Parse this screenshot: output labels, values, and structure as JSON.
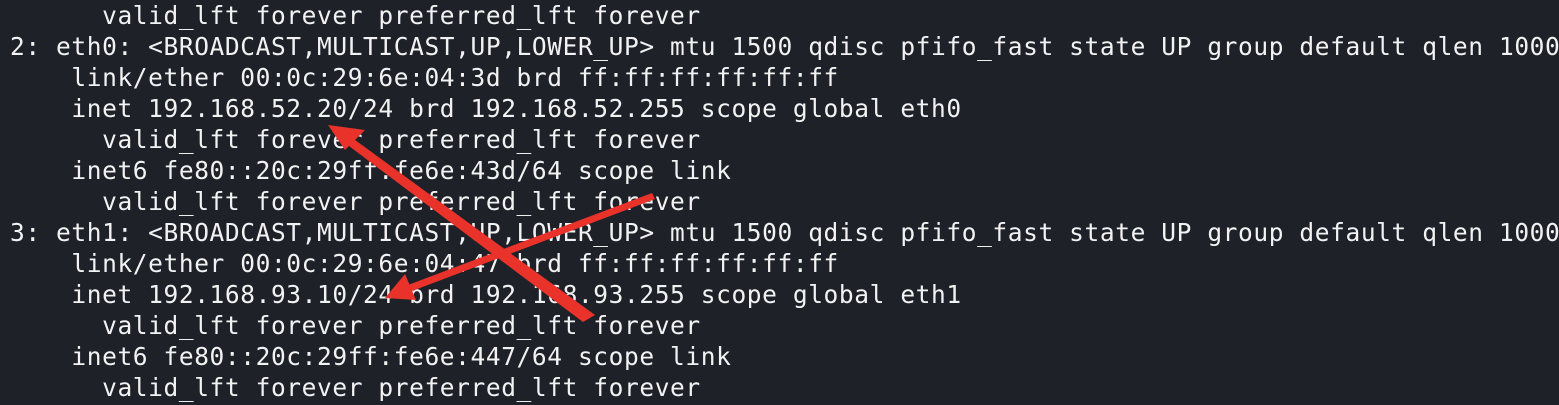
{
  "terminal": {
    "lines": [
      "      valid_lft forever preferred_lft forever",
      "2: eth0: <BROADCAST,MULTICAST,UP,LOWER_UP> mtu 1500 qdisc pfifo_fast state UP group default qlen 1000",
      "    link/ether 00:0c:29:6e:04:3d brd ff:ff:ff:ff:ff:ff",
      "    inet 192.168.52.20/24 brd 192.168.52.255 scope global eth0",
      "      valid_lft forever preferred_lft forever",
      "    inet6 fe80::20c:29ff:fe6e:43d/64 scope link",
      "      valid_lft forever preferred_lft forever",
      "3: eth1: <BROADCAST,MULTICAST,UP,LOWER_UP> mtu 1500 qdisc pfifo_fast state UP group default qlen 1000",
      "    link/ether 00:0c:29:6e:04:47 brd ff:ff:ff:ff:ff:ff",
      "    inet 192.168.93.10/24 brd 192.168.93.255 scope global eth1",
      "      valid_lft forever preferred_lft forever",
      "    inet6 fe80::20c:29ff:fe6e:447/64 scope link",
      "      valid_lft forever preferred_lft forever"
    ]
  },
  "colors": {
    "background": "#1f2129",
    "text": "#f2f2f2",
    "annotation_arrow": "#e8322a"
  },
  "annotations": {
    "arrow_count": 2,
    "arrow_1": "red arrow pointing to 192.168.52.20/24",
    "arrow_2": "red arrow pointing to 192.168.93.10/24"
  }
}
